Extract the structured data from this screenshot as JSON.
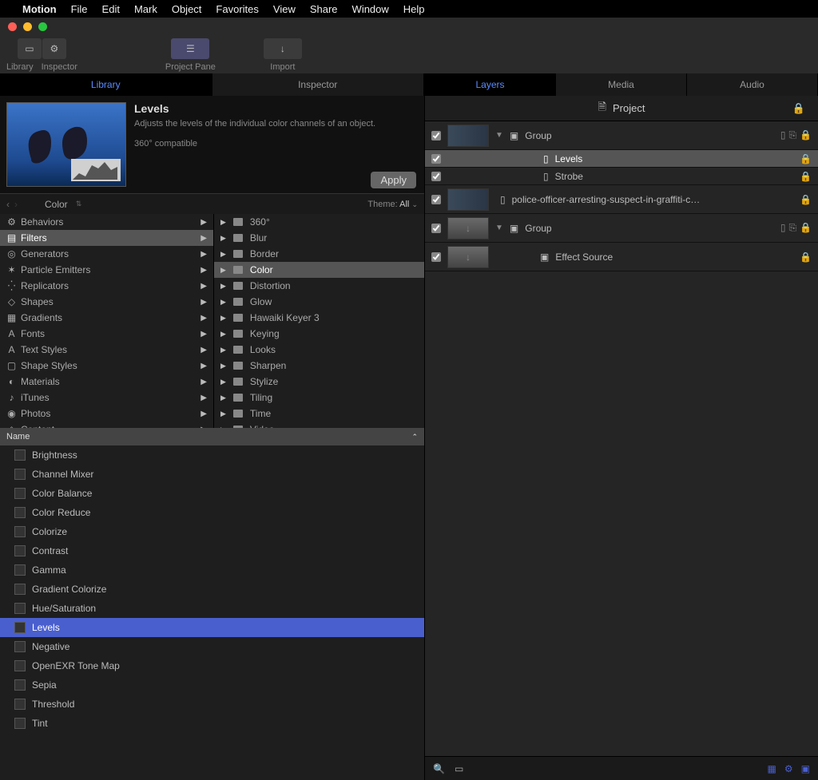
{
  "menubar": {
    "app": "Motion",
    "items": [
      "File",
      "Edit",
      "Mark",
      "Object",
      "Favorites",
      "View",
      "Share",
      "Window",
      "Help"
    ]
  },
  "toolbar": {
    "library": "Library",
    "inspector": "Inspector",
    "projectpane": "Project Pane",
    "import": "Import"
  },
  "leftTabs": {
    "library": "Library",
    "inspector": "Inspector"
  },
  "preview": {
    "title": "Levels",
    "desc1": "Adjusts the levels of the individual color channels of an object.",
    "desc2": "360° compatible",
    "apply": "Apply"
  },
  "pathbar": {
    "label": "Color",
    "themeLabel": "Theme:",
    "themeVal": "All"
  },
  "categories": [
    {
      "label": "Behaviors",
      "icon": "⚙"
    },
    {
      "label": "Filters",
      "icon": "▤",
      "sel": true
    },
    {
      "label": "Generators",
      "icon": "◎"
    },
    {
      "label": "Particle Emitters",
      "icon": "✶"
    },
    {
      "label": "Replicators",
      "icon": "⁛"
    },
    {
      "label": "Shapes",
      "icon": "◇"
    },
    {
      "label": "Gradients",
      "icon": "▦"
    },
    {
      "label": "Fonts",
      "icon": "A"
    },
    {
      "label": "Text Styles",
      "icon": "A"
    },
    {
      "label": "Shape Styles",
      "icon": "▢"
    },
    {
      "label": "Materials",
      "icon": "◐"
    },
    {
      "label": "iTunes",
      "icon": "♪"
    },
    {
      "label": "Photos",
      "icon": "◉"
    },
    {
      "label": "Content",
      "icon": "◈"
    }
  ],
  "subcats": [
    "360°",
    "Blur",
    "Border",
    "Color",
    "Distortion",
    "Glow",
    "Hawaiki Keyer 3",
    "Keying",
    "Looks",
    "Sharpen",
    "Stylize",
    "Tiling",
    "Time",
    "Video"
  ],
  "subcatSelected": "Color",
  "nameHeader": "Name",
  "results": [
    "Brightness",
    "Channel Mixer",
    "Color Balance",
    "Color Reduce",
    "Colorize",
    "Contrast",
    "Gamma",
    "Gradient Colorize",
    "Hue/Saturation",
    "Levels",
    "Negative",
    "OpenEXR Tone Map",
    "Sepia",
    "Threshold",
    "Tint"
  ],
  "resultSelected": "Levels",
  "rightTabs": {
    "layers": "Layers",
    "media": "Media",
    "audio": "Audio"
  },
  "project": {
    "title": "Project"
  },
  "layers": [
    {
      "type": "group",
      "name": "Group",
      "thumb": "video",
      "checked": true
    },
    {
      "type": "filter",
      "name": "Levels",
      "checked": true,
      "sel": true
    },
    {
      "type": "filter",
      "name": "Strobe",
      "checked": true
    },
    {
      "type": "clip",
      "name": "police-officer-arresting-suspect-in-graffiti-c…",
      "thumb": "video",
      "checked": true
    },
    {
      "type": "group",
      "name": "Group",
      "thumb": "placeholder",
      "checked": true
    },
    {
      "type": "source",
      "name": "Effect Source",
      "thumb": "placeholder",
      "checked": true
    }
  ]
}
